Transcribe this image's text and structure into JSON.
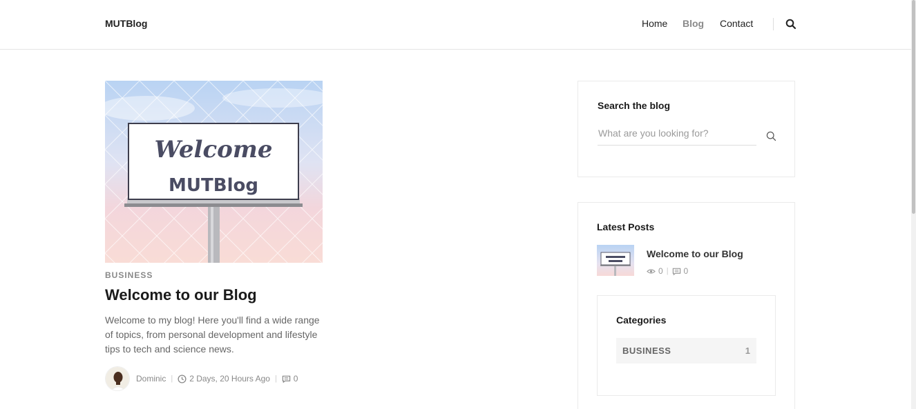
{
  "header": {
    "brand": "MUTBlog",
    "nav": {
      "home": "Home",
      "blog": "Blog",
      "contact": "Contact"
    },
    "search_icon": "search-icon"
  },
  "post": {
    "category": "BUSINESS",
    "title": "Welcome to our Blog",
    "excerpt": "Welcome to my blog! Here you'll find a wide range of topics, from personal development and lifestyle tips to tech and science news.",
    "image_text": {
      "line1": "Welcome",
      "line2": "MUTBlog"
    },
    "author": "Dominic",
    "time": "2 Days, 20 Hours Ago",
    "comments": "0"
  },
  "sidebar": {
    "search": {
      "title": "Search the blog",
      "placeholder": "What are you looking for?"
    },
    "latest": {
      "title": "Latest Posts",
      "items": [
        {
          "title": "Welcome to our Blog",
          "views": "0",
          "comments": "0"
        }
      ]
    },
    "categories": {
      "title": "Categories",
      "items": [
        {
          "name": "BUSINESS",
          "count": "1"
        }
      ]
    }
  },
  "colors": {
    "accent_nav": "#8a8a8a",
    "text": "#222222",
    "muted": "#888888"
  }
}
